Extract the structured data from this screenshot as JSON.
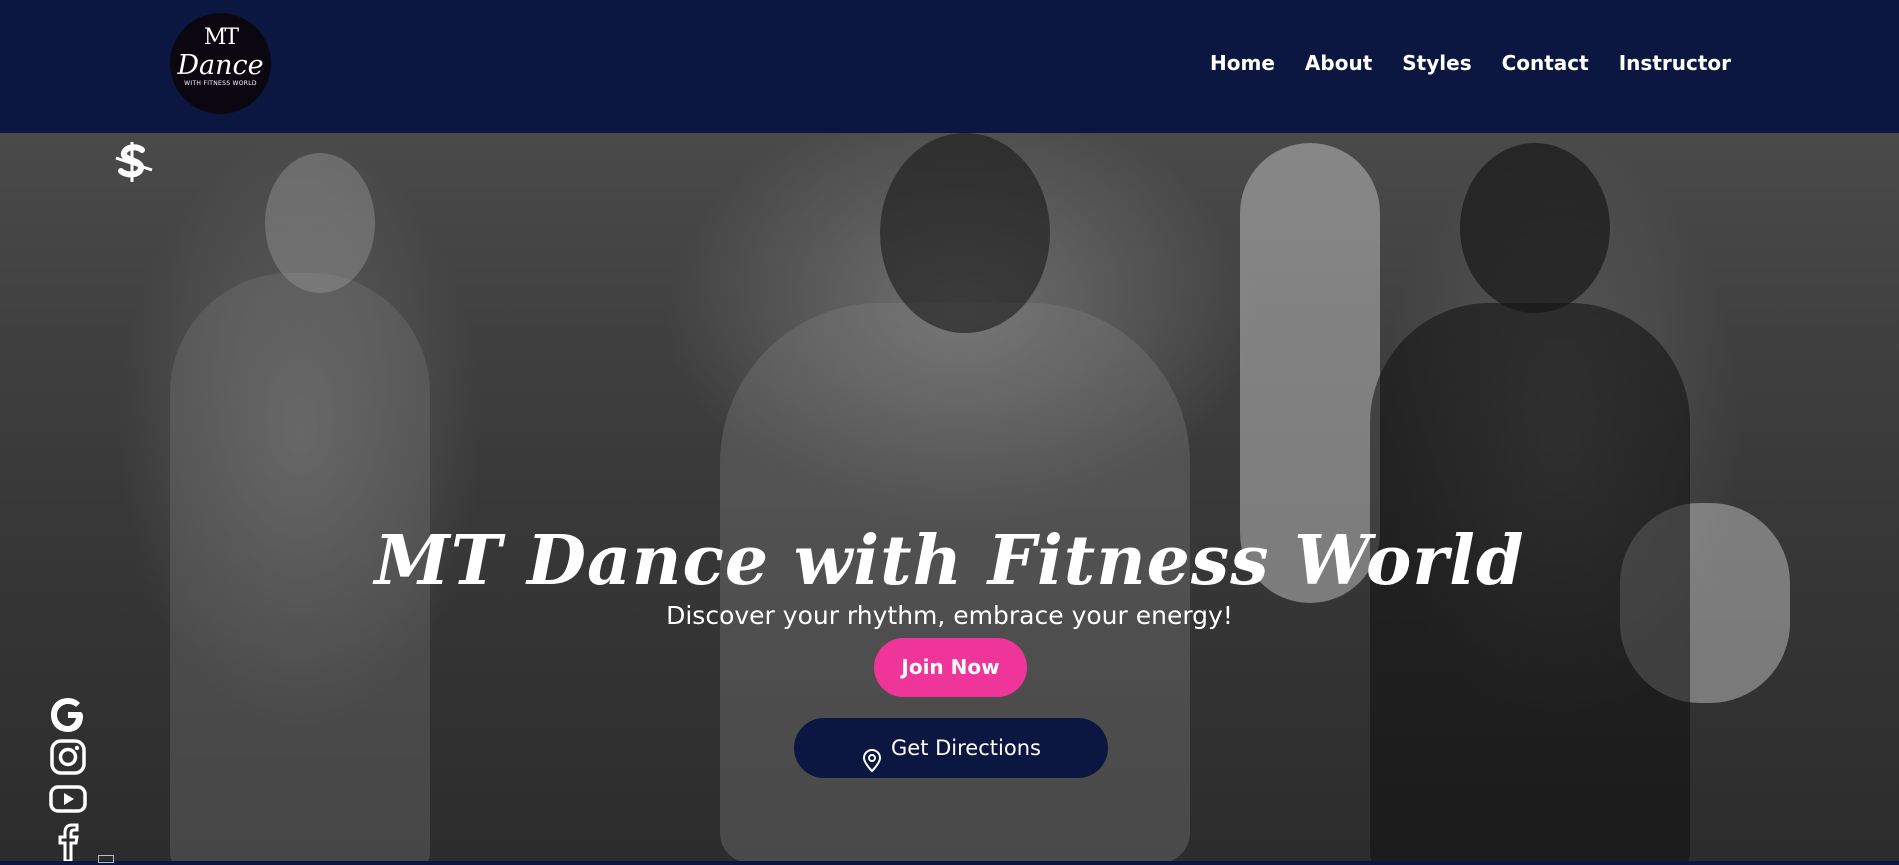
{
  "header": {
    "logo": {
      "line1": "MT",
      "line2": "Dance",
      "line3": "WITH FITNESS WORLD"
    },
    "nav": [
      {
        "label": "Home"
      },
      {
        "label": "About"
      },
      {
        "label": "Styles"
      },
      {
        "label": "Contact"
      },
      {
        "label": "Instructor"
      }
    ]
  },
  "hero": {
    "title": "MT Dance with Fitness World",
    "subtitle": "Discover your rhythm, embrace your energy!",
    "join_label": "Join Now",
    "directions_label": "Get Directions",
    "directions_icon": "map-pin-icon"
  },
  "floating_badge_icon": "dollar-sign-icon",
  "social_icons": [
    "google-icon",
    "instagram-icon",
    "youtube-icon",
    "facebook-icon"
  ],
  "colors": {
    "navy": "#0b1740",
    "pink": "#f0359a",
    "white": "#ffffff"
  }
}
